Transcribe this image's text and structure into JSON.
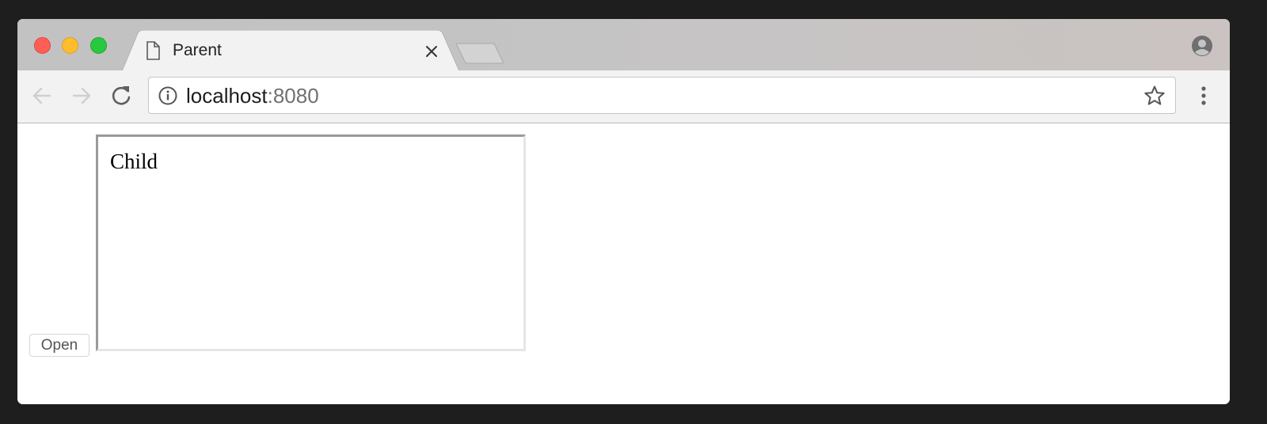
{
  "browser": {
    "tab": {
      "title": "Parent",
      "icon": "document-icon"
    },
    "address_bar": {
      "host": "localhost",
      "port": ":8080",
      "icons": [
        "info-icon",
        "star-icon"
      ]
    },
    "toolbar_icons": [
      "back-arrow-icon",
      "forward-arrow-icon",
      "reload-icon",
      "menu-dots-icon"
    ],
    "profile_icon": "profile-icon",
    "colors": {
      "close": "#fd5f57",
      "minimize": "#febc2e",
      "maximize": "#28c840"
    }
  },
  "page": {
    "open_button_label": "Open",
    "child_frame_text": "Child"
  }
}
